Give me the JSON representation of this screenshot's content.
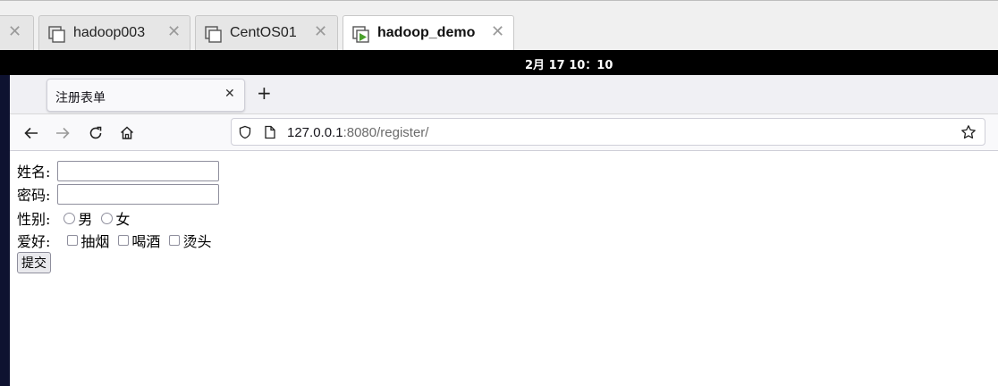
{
  "vm_tabs": [
    {
      "label": "",
      "active": false
    },
    {
      "label": "hadoop003",
      "active": false
    },
    {
      "label": "CentOS01",
      "active": false
    },
    {
      "label": "hadoop_demo",
      "active": true
    }
  ],
  "topbar": {
    "clock": "2月 17  10：10"
  },
  "browser": {
    "tab_title": "注册表单",
    "url_host": "127.0.0.1",
    "url_path": ":8080/register/"
  },
  "form": {
    "name_label": "姓名:",
    "password_label": "密码:",
    "gender_label": "性别:",
    "gender_options": [
      "男",
      "女"
    ],
    "hobby_label": "爱好:",
    "hobby_options": [
      "抽烟",
      "喝酒",
      "烫头"
    ],
    "submit_label": "提交"
  },
  "colors": {
    "accent_play": "#4aa02c",
    "topbar": "#000000"
  }
}
